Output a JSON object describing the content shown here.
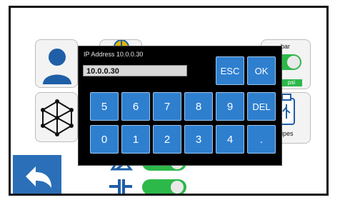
{
  "keypad": {
    "ip_caption": "IP Address  10.0.0.30",
    "ip_value": "10.0.0.30",
    "esc_label": "ESC",
    "ok_label": "OK",
    "del_label": "DEL",
    "row1": [
      "5",
      "6",
      "7",
      "8",
      "9"
    ],
    "row2": [
      "0",
      "1",
      "2",
      "3",
      "4",
      "."
    ]
  },
  "settings": {
    "unit_label": "bar",
    "unit_alt": "psi",
    "recipes_label": "Recipes"
  },
  "colors": {
    "key_blue": "#2f7fcf",
    "toggle_green": "#2db84a",
    "back_blue": "#2a6fb8"
  },
  "icons": [
    "user-icon",
    "network-icon",
    "globe-icon",
    "usb-icon",
    "back-arrow-icon",
    "valve-icon",
    "pressure-icon"
  ]
}
